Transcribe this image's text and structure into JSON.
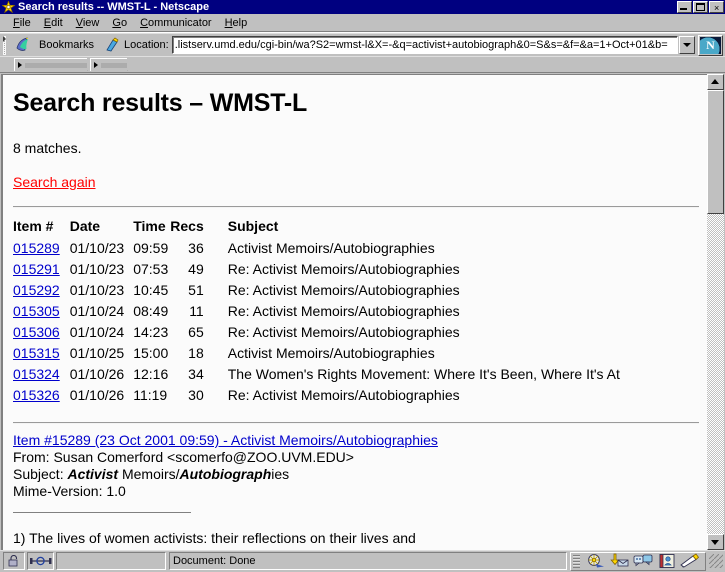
{
  "window": {
    "title": "Search results -- WMST-L - Netscape",
    "title_icon": "netscape-star-icon",
    "controls": {
      "minimize": "_",
      "maximize": "□",
      "close": "✕"
    }
  },
  "menubar": {
    "items": [
      {
        "name": "file",
        "accel": "F",
        "rest": "ile"
      },
      {
        "name": "edit",
        "accel": "E",
        "rest": "dit"
      },
      {
        "name": "view",
        "accel": "V",
        "rest": "iew"
      },
      {
        "name": "go",
        "accel": "G",
        "rest": "o"
      },
      {
        "name": "communicator",
        "accel": "C",
        "rest": "ommunicator"
      },
      {
        "name": "help",
        "accel": "H",
        "rest": "elp"
      }
    ]
  },
  "toolbar": {
    "bookmarks_label": "Bookmarks",
    "location_label": "Location:",
    "url": ".listserv.umd.edu/cgi-bin/wa?S2=wmst-l&X=-&q=activist+autobiograph&0=S&s=&f=&a=1+Oct+01&b=",
    "url_placeholder": "Location:",
    "logo_letter": "N"
  },
  "page": {
    "heading": "Search results – WMST-L",
    "matches": "8 matches.",
    "search_again": "Search again",
    "table": {
      "headers": [
        "Item #",
        "Date",
        "Time",
        "Recs",
        "Subject"
      ],
      "rows": [
        {
          "item": "015289",
          "date": "01/10/23",
          "time": "09:59",
          "recs": "36",
          "subject": "Activist Memoirs/Autobiographies"
        },
        {
          "item": "015291",
          "date": "01/10/23",
          "time": "07:53",
          "recs": "49",
          "subject": "Re: Activist Memoirs/Autobiographies"
        },
        {
          "item": "015292",
          "date": "01/10/23",
          "time": "10:45",
          "recs": "51",
          "subject": "Re: Activist Memoirs/Autobiographies"
        },
        {
          "item": "015305",
          "date": "01/10/24",
          "time": "08:49",
          "recs": "11",
          "subject": "Re: Activist Memoirs/Autobiographies"
        },
        {
          "item": "015306",
          "date": "01/10/24",
          "time": "14:23",
          "recs": "65",
          "subject": "Re: Activist Memoirs/Autobiographies"
        },
        {
          "item": "015315",
          "date": "01/10/25",
          "time": "15:00",
          "recs": "18",
          "subject": "Activist Memoirs/Autobiographies"
        },
        {
          "item": "015324",
          "date": "01/10/26",
          "time": "12:16",
          "recs": "34",
          "subject": "The Women's Rights Movement: Where It's Been, Where It's At"
        },
        {
          "item": "015326",
          "date": "01/10/26",
          "time": "11:19",
          "recs": "30",
          "subject": "Re: Activist Memoirs/Autobiographies"
        }
      ]
    },
    "message": {
      "link": "Item #15289 (23 Oct 2001 09:59) - Activist Memoirs/Autobiographies",
      "from": "From: Susan Comerford <scomerfo@ZOO.UVM.EDU>",
      "subject_prefix": "Subject: ",
      "subject_hl1": "Activist",
      "subject_mid": " Memoirs/",
      "subject_hl2": "Autobiograph",
      "subject_tail": "ies",
      "mime": "Mime-Version: 1.0",
      "body_prefix": "1) The lives of women ",
      "body_hl": "activist",
      "body_tail": "s: their reflections on their lives and"
    }
  },
  "statusbar": {
    "document_status": "Document: Done",
    "component_icons": [
      "navigator-icon",
      "inbox-icon",
      "discussions-icon",
      "address-book-icon",
      "composer-icon"
    ]
  },
  "colors": {
    "titlebar": "#000080",
    "chrome": "#c0c0c0",
    "page_bg": "#fbfbfb",
    "link_blue": "#0000cc",
    "link_red": "#ff0000"
  }
}
